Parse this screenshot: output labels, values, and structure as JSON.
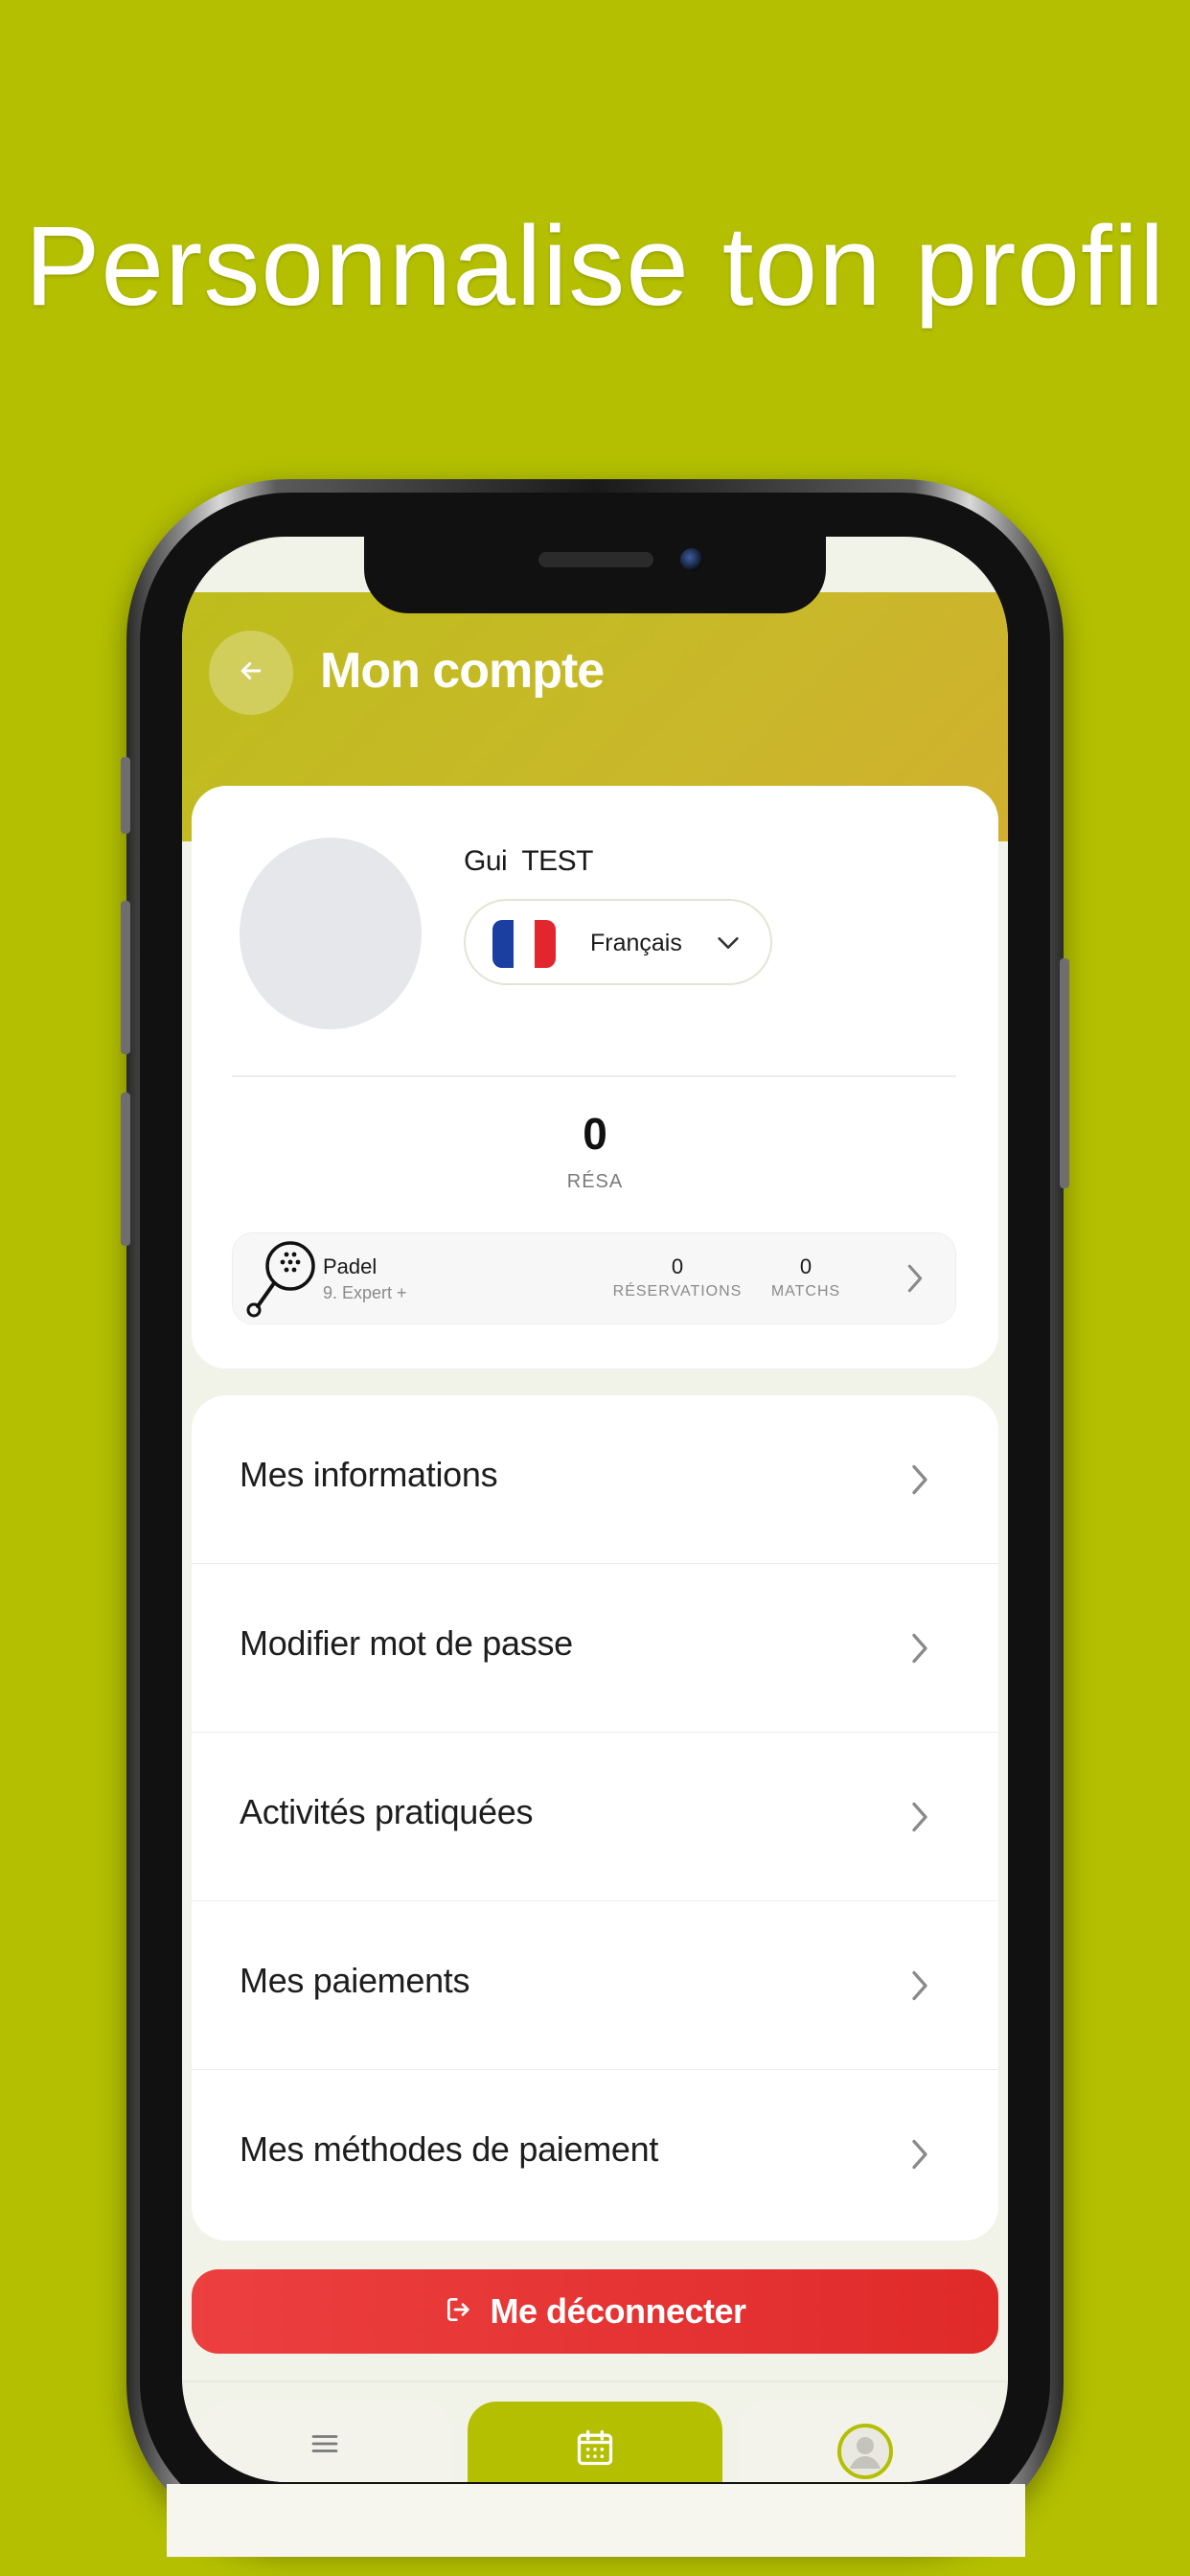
{
  "headline": "Personnalise ton profil",
  "colors": {
    "background": "#b3bf00",
    "accent": "#b3bf00",
    "header_gradient": "#c9b82a",
    "logout": "#e53535"
  },
  "header": {
    "back_icon": "arrow-left-icon",
    "title": "Mon compte"
  },
  "profile": {
    "name": "Gui  TEST",
    "language": {
      "flag_icon": "france-flag-icon",
      "label": "Français"
    },
    "resa_count": "0",
    "resa_label": "RÉSA",
    "sport": {
      "icon": "padel-racket-icon",
      "name": "Padel",
      "level": "9. Expert +",
      "reservations_value": "0",
      "reservations_label": "RÉSERVATIONS",
      "matches_value": "0",
      "matches_label": "MATCHS"
    }
  },
  "menu": {
    "items": [
      {
        "label": "Mes informations"
      },
      {
        "label": "Modifier mot de passe"
      },
      {
        "label": "Activités pratiquées"
      },
      {
        "label": "Mes paiements"
      },
      {
        "label": "Mes méthodes de paiement"
      }
    ]
  },
  "logout": {
    "icon": "logout-icon",
    "label": "Me déconnecter"
  },
  "tabbar": {
    "items": [
      {
        "icon": "menu-icon",
        "active": false
      },
      {
        "icon": "calendar-icon",
        "active": true
      },
      {
        "icon": "profile-avatar-icon",
        "active": false
      }
    ]
  }
}
